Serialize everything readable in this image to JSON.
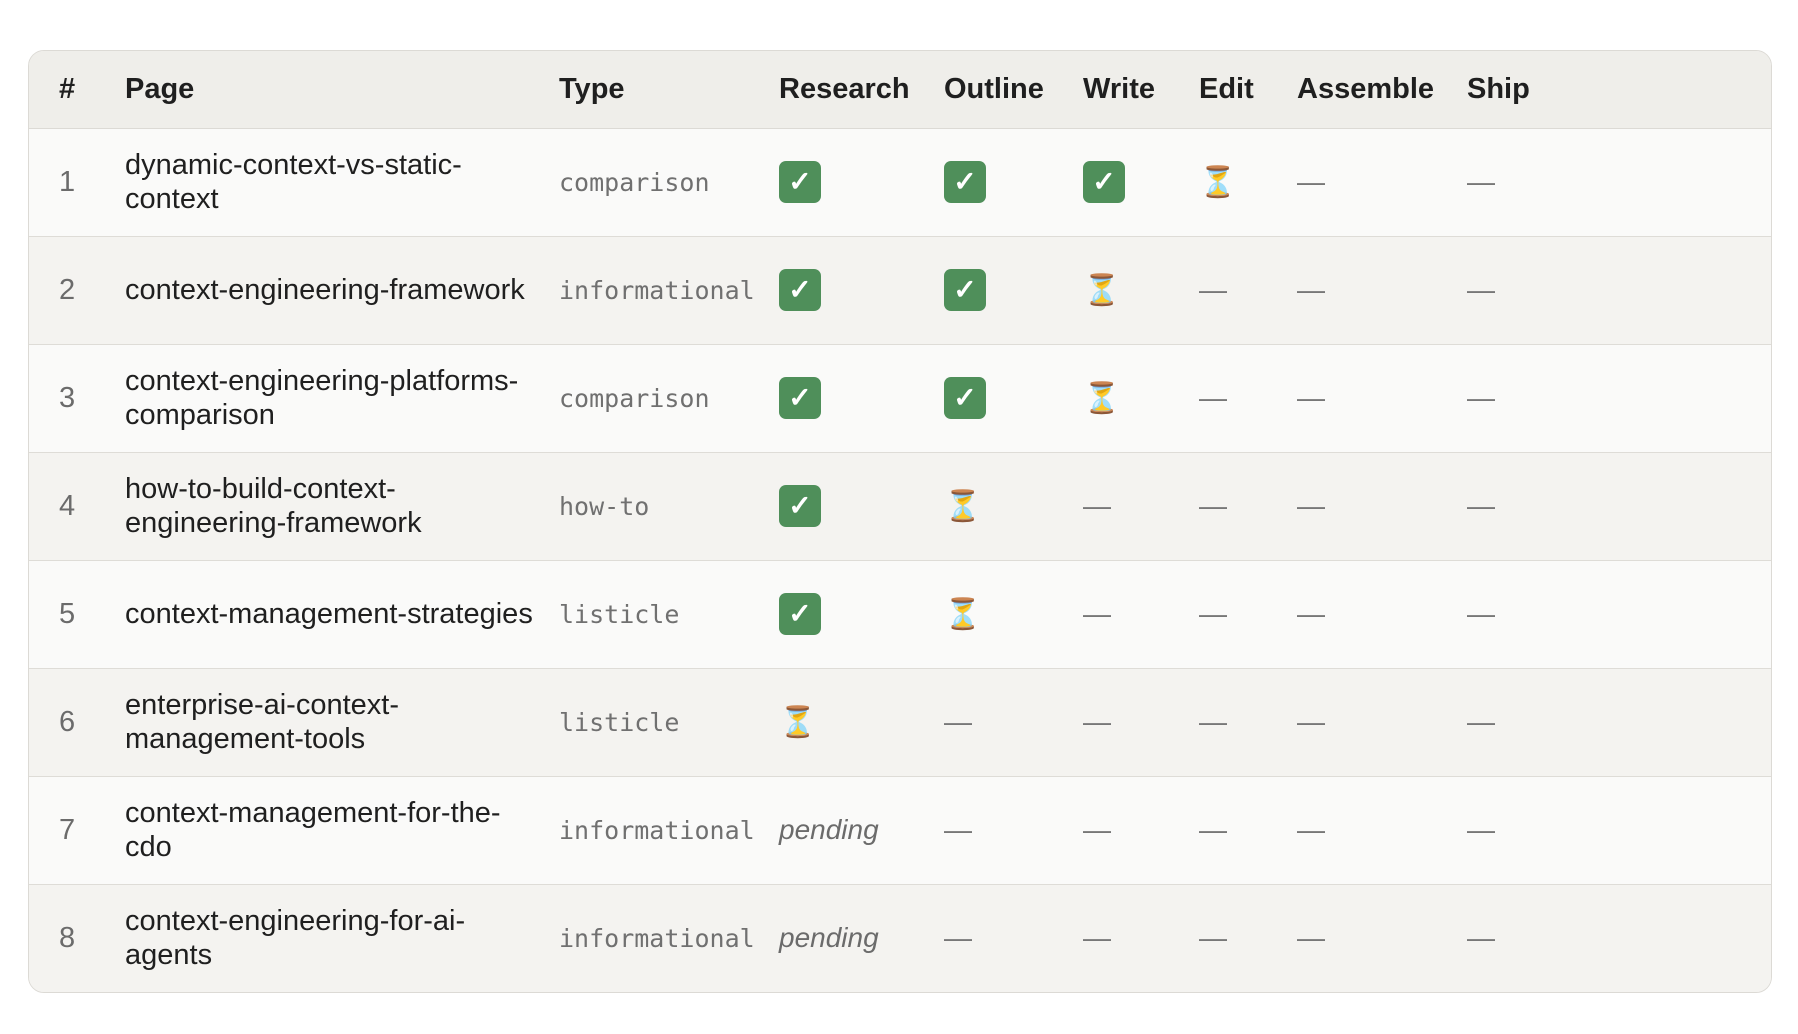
{
  "headers": {
    "num": "#",
    "page": "Page",
    "type": "Type",
    "research": "Research",
    "outline": "Outline",
    "write": "Write",
    "edit": "Edit",
    "assemble": "Assemble",
    "ship": "Ship"
  },
  "symbols": {
    "done": "✓",
    "in_progress": "⏳",
    "not_started": "—",
    "pending": "pending"
  },
  "colors": {
    "done_bg": "#4f8f5a",
    "header_bg": "#efeeea"
  },
  "rows": [
    {
      "num": "1",
      "page": "dynamic-context-vs-static-context",
      "type": "comparison",
      "stages": [
        "done",
        "done",
        "done",
        "in_progress",
        "not_started",
        "not_started"
      ]
    },
    {
      "num": "2",
      "page": "context-engineering-framework",
      "type": "informational",
      "stages": [
        "done",
        "done",
        "in_progress",
        "not_started",
        "not_started",
        "not_started"
      ]
    },
    {
      "num": "3",
      "page": "context-engineering-platforms-comparison",
      "type": "comparison",
      "stages": [
        "done",
        "done",
        "in_progress",
        "not_started",
        "not_started",
        "not_started"
      ]
    },
    {
      "num": "4",
      "page": "how-to-build-context-engineering-framework",
      "type": "how-to",
      "stages": [
        "done",
        "in_progress",
        "not_started",
        "not_started",
        "not_started",
        "not_started"
      ]
    },
    {
      "num": "5",
      "page": "context-management-strategies",
      "type": "listicle",
      "stages": [
        "done",
        "in_progress",
        "not_started",
        "not_started",
        "not_started",
        "not_started"
      ]
    },
    {
      "num": "6",
      "page": "enterprise-ai-context-management-tools",
      "type": "listicle",
      "stages": [
        "in_progress",
        "not_started",
        "not_started",
        "not_started",
        "not_started",
        "not_started"
      ]
    },
    {
      "num": "7",
      "page": "context-management-for-the-cdo",
      "type": "informational",
      "stages": [
        "pending",
        "not_started",
        "not_started",
        "not_started",
        "not_started",
        "not_started"
      ]
    },
    {
      "num": "8",
      "page": "context-engineering-for-ai-agents",
      "type": "informational",
      "stages": [
        "pending",
        "not_started",
        "not_started",
        "not_started",
        "not_started",
        "not_started"
      ]
    }
  ]
}
